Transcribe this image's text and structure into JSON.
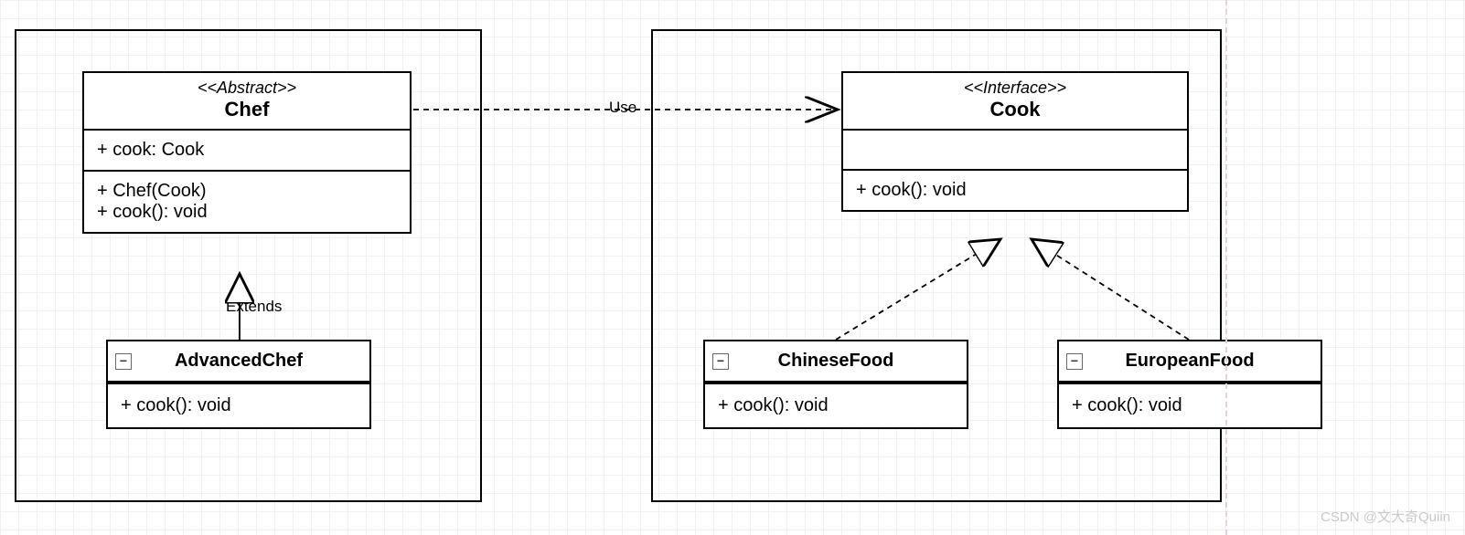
{
  "classes": {
    "chef": {
      "stereotype": "<<Abstract>>",
      "name": "Chef",
      "attrs": "+ cook: Cook",
      "ops1": "+ Chef(Cook)",
      "ops2": "+ cook(): void"
    },
    "cook": {
      "stereotype": "<<Interface>>",
      "name": "Cook",
      "ops": "+ cook(): void"
    },
    "advancedChef": {
      "name": "AdvancedChef",
      "ops": "+ cook(): void"
    },
    "chineseFood": {
      "name": "ChineseFood",
      "ops": "+ cook(): void"
    },
    "europeanFood": {
      "name": "EuropeanFood",
      "ops": "+ cook(): void"
    }
  },
  "relations": {
    "use": "Use",
    "extends": "Extends"
  },
  "collapse_glyph": "▭",
  "watermark": "CSDN @文大奇Quiin"
}
